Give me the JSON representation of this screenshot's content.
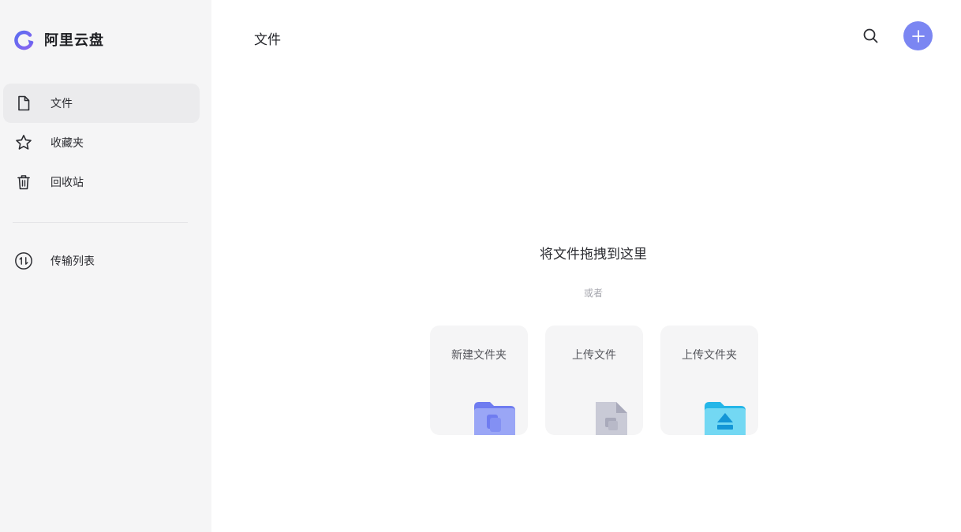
{
  "app": {
    "name": "阿里云盘"
  },
  "colors": {
    "accent": "#7b86f2",
    "sidebar_bg": "#f5f5f6",
    "active_item_bg": "#ebebed"
  },
  "sidebar": {
    "items": [
      {
        "label": "文件",
        "icon": "file-icon",
        "active": true
      },
      {
        "label": "收藏夹",
        "icon": "star-icon",
        "active": false
      },
      {
        "label": "回收站",
        "icon": "trash-icon",
        "active": false
      }
    ],
    "secondary": [
      {
        "label": "传输列表",
        "icon": "transfer-icon",
        "active": false
      }
    ]
  },
  "header": {
    "title": "文件"
  },
  "empty_state": {
    "title": "将文件拖拽到这里",
    "or_text": "或者",
    "actions": [
      {
        "label": "新建文件夹",
        "icon": "new-folder-icon"
      },
      {
        "label": "上传文件",
        "icon": "upload-file-icon"
      },
      {
        "label": "上传文件夹",
        "icon": "upload-folder-icon"
      }
    ]
  }
}
